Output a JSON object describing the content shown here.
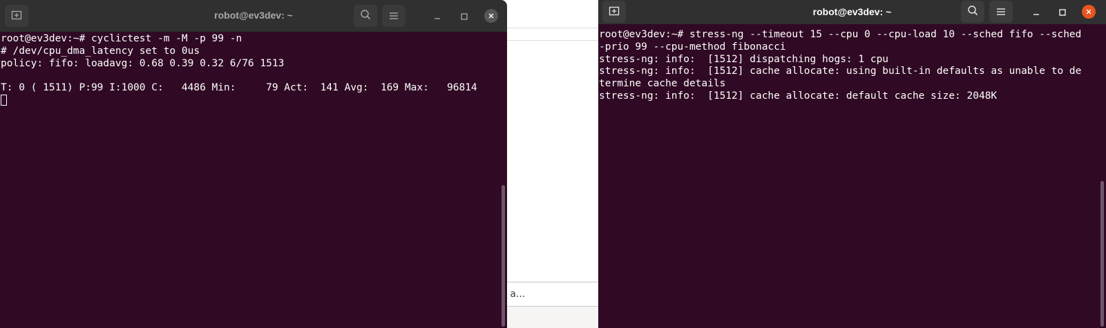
{
  "background_window": {
    "field_text": "Ir a..."
  },
  "left_terminal": {
    "title": "robot@ev3dev: ~",
    "new_tab_icon": "new-tab-icon",
    "search_icon": "search-icon",
    "menu_icon": "hamburger-menu-icon",
    "lines": [
      "root@ev3dev:~# cyclictest -m -M -p 99 -n",
      "# /dev/cpu_dma_latency set to 0us",
      "policy: fifo: loadavg: 0.68 0.39 0.32 6/76 1513",
      "",
      "T: 0 ( 1511) P:99 I:1000 C:   4486 Min:     79 Act:  141 Avg:  169 Max:   96814"
    ]
  },
  "right_terminal": {
    "title": "robot@ev3dev: ~",
    "new_tab_icon": "new-tab-icon",
    "search_icon": "search-icon",
    "menu_icon": "hamburger-menu-icon",
    "lines": [
      "root@ev3dev:~# stress-ng --timeout 15 --cpu 0 --cpu-load 10 --sched fifo --sched",
      "-prio 99 --cpu-method fibonacci",
      "stress-ng: info:  [1512] dispatching hogs: 1 cpu",
      "stress-ng: info:  [1512] cache allocate: using built-in defaults as unable to de",
      "termine cache details",
      "stress-ng: info:  [1512] cache allocate: default cache size: 2048K"
    ]
  },
  "colors": {
    "terminal_bg": "#300a24",
    "titlebar_bg": "#303030",
    "close_accent": "#e95420"
  }
}
